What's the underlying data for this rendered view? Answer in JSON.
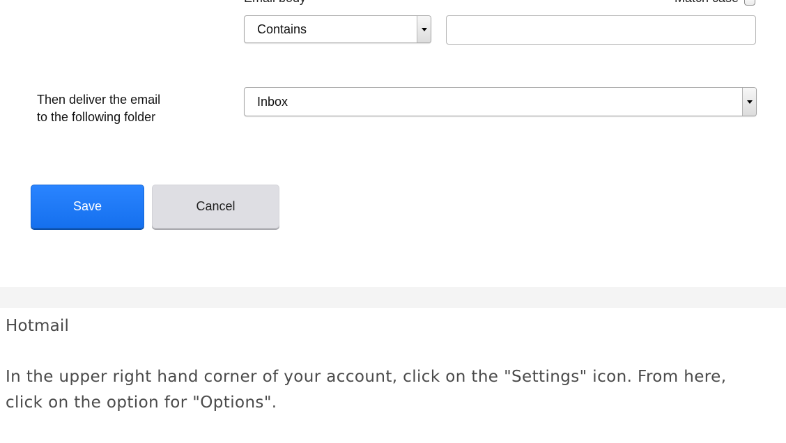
{
  "form": {
    "email_body_label": "Email body",
    "match_case_label": "Match case",
    "match_case_checked": false,
    "condition_select_value": "Contains",
    "condition_text_value": "",
    "deliver_label_line1": "Then deliver the email",
    "deliver_label_line2": "to the following folder",
    "folder_select_value": "Inbox",
    "save_label": "Save",
    "cancel_label": "Cancel"
  },
  "article": {
    "heading": "Hotmail",
    "body": "In the upper right hand corner of your account, click on the \"Settings\" icon. From here, click on the option for \"Options\"."
  },
  "colors": {
    "save_button": "#1a74f5",
    "cancel_button": "#dedee3",
    "divider_band": "#f4f4f4",
    "article_text": "#4a4a4a"
  }
}
